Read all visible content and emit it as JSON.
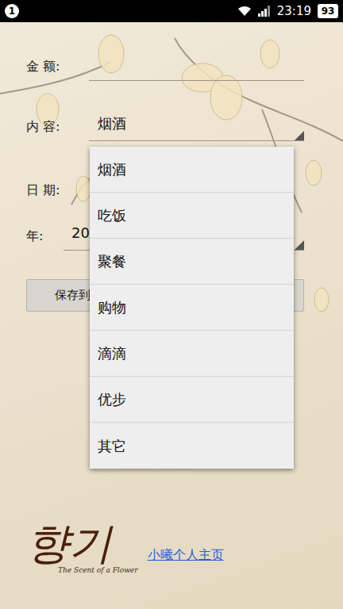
{
  "status_bar": {
    "notification_count": "1",
    "time": "23:19",
    "battery": "93"
  },
  "form": {
    "amount_label": "金 额:",
    "content_label": "内 容:",
    "content_value": "烟酒",
    "date_label": "日 期:",
    "year_label": "年:",
    "year_value": "20",
    "save_button": "保存到"
  },
  "dropdown": {
    "expanded": true,
    "items": [
      {
        "label": "烟酒"
      },
      {
        "label": "吃饭"
      },
      {
        "label": "聚餐"
      },
      {
        "label": "购物"
      },
      {
        "label": "滴滴"
      },
      {
        "label": "优步"
      },
      {
        "label": "其它"
      }
    ]
  },
  "logo": {
    "script": "향기",
    "tagline": "The Scent of a Flower"
  },
  "home_link": {
    "label": "小曦个人主页"
  }
}
